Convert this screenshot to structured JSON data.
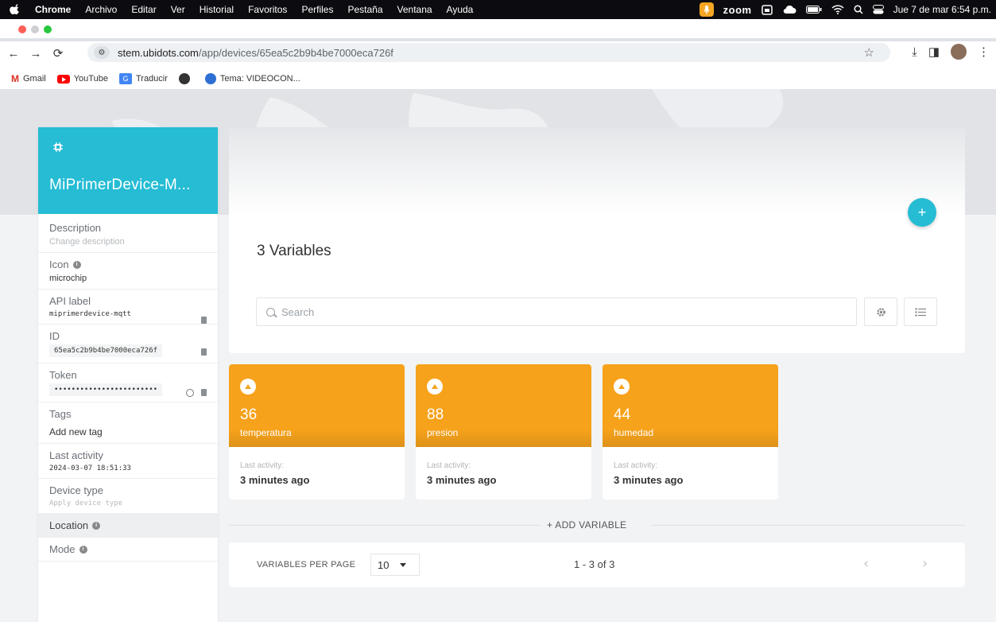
{
  "menubar": {
    "app_name": "Chrome",
    "items": [
      "Archivo",
      "Editar",
      "Ver",
      "Historial",
      "Favoritos",
      "Perfiles",
      "Pestaña",
      "Ventana",
      "Ayuda"
    ],
    "zoom": "zoom",
    "datetime": "Jue 7 de mar  6:54 p.m."
  },
  "browser": {
    "url_host": "stem.ubidots.com",
    "url_path": "/app/devices/65ea5c2b9b4be7000eca726f",
    "bookmarks": [
      "Gmail",
      "YouTube",
      "Traducir",
      "",
      "Tema: VIDEOCON..."
    ]
  },
  "device": {
    "name": "MiPrimerDevice-M...",
    "properties": {
      "description_label": "Description",
      "description_value": "Change description",
      "icon_label": "Icon",
      "icon_value": "microchip",
      "api_label_label": "API label",
      "api_label_value": "miprimerdevice-mqtt",
      "id_label": "ID",
      "id_value": "65ea5c2b9b4be7000eca726f",
      "token_label": "Token",
      "token_value": "••••••••••••••••••••••••",
      "tags_label": "Tags",
      "tags_value": "Add new tag",
      "last_activity_label": "Last activity",
      "last_activity_value": "2024-03-07 18:51:33",
      "device_type_label": "Device type",
      "device_type_value": "Apply device type",
      "location_label": "Location",
      "mode_label": "Mode"
    }
  },
  "main": {
    "add_button": "+",
    "title": "3 Variables",
    "search_placeholder": "Search",
    "variables": [
      {
        "value": "36",
        "name": "temperatura",
        "last_label": "Last activity:",
        "last_value": "3 minutes ago"
      },
      {
        "value": "88",
        "name": "presion",
        "last_label": "Last activity:",
        "last_value": "3 minutes ago"
      },
      {
        "value": "44",
        "name": "humedad",
        "last_label": "Last activity:",
        "last_value": "3 minutes ago"
      }
    ],
    "add_variable": "+ ADD VARIABLE",
    "pager": {
      "per_page_label": "VARIABLES PER PAGE",
      "per_page_value": "10",
      "range": "1 - 3 of 3",
      "prev": "‹",
      "next": "›"
    }
  },
  "colors": {
    "accent": "#25bcd4",
    "variable_card": "#f6a21b"
  }
}
